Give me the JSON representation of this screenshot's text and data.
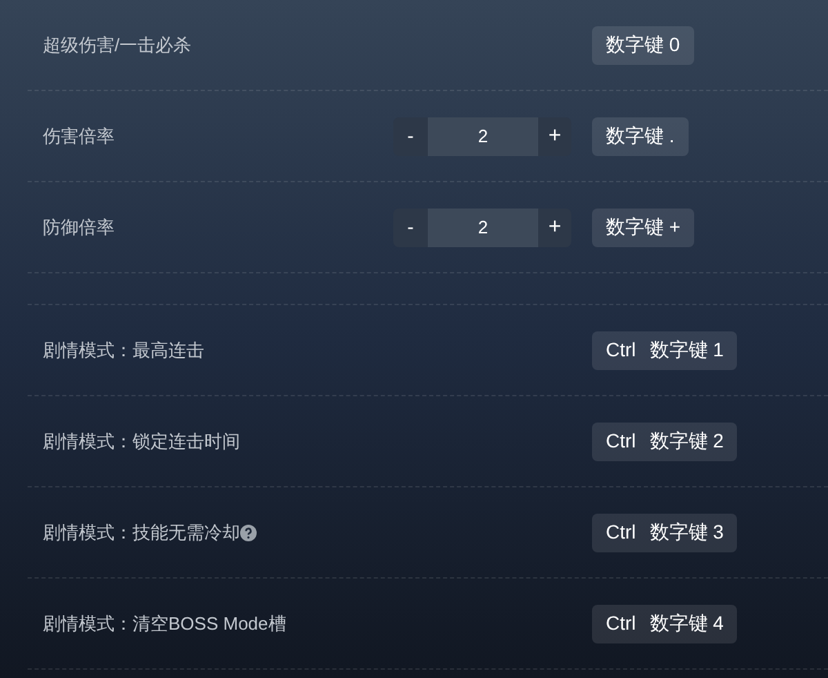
{
  "sections": [
    {
      "rows": [
        {
          "kind": "plain",
          "label": "超级伤害/一击必杀",
          "hotkey": [
            "数字键 0"
          ]
        },
        {
          "kind": "stepper",
          "label": "伤害倍率",
          "minus": "-",
          "value": "2",
          "plus": "+",
          "hotkey": [
            "数字键 ."
          ]
        },
        {
          "kind": "stepper",
          "label": "防御倍率",
          "minus": "-",
          "value": "2",
          "plus": "+",
          "hotkey": [
            "数字键 +"
          ]
        }
      ]
    },
    {
      "rows": [
        {
          "kind": "plain",
          "label": "剧情模式：最高连击",
          "hotkey": [
            "Ctrl",
            "数字键 1"
          ]
        },
        {
          "kind": "plain",
          "label": "剧情模式：锁定连击时间",
          "hotkey": [
            "Ctrl",
            "数字键 2"
          ]
        },
        {
          "kind": "plain",
          "label": "剧情模式：技能无需冷却",
          "help": true,
          "hotkey": [
            "Ctrl",
            "数字键 3"
          ]
        },
        {
          "kind": "plain",
          "label": "剧情模式：清空BOSS Mode槽",
          "hotkey": [
            "Ctrl",
            "数字键 4"
          ]
        }
      ]
    }
  ]
}
